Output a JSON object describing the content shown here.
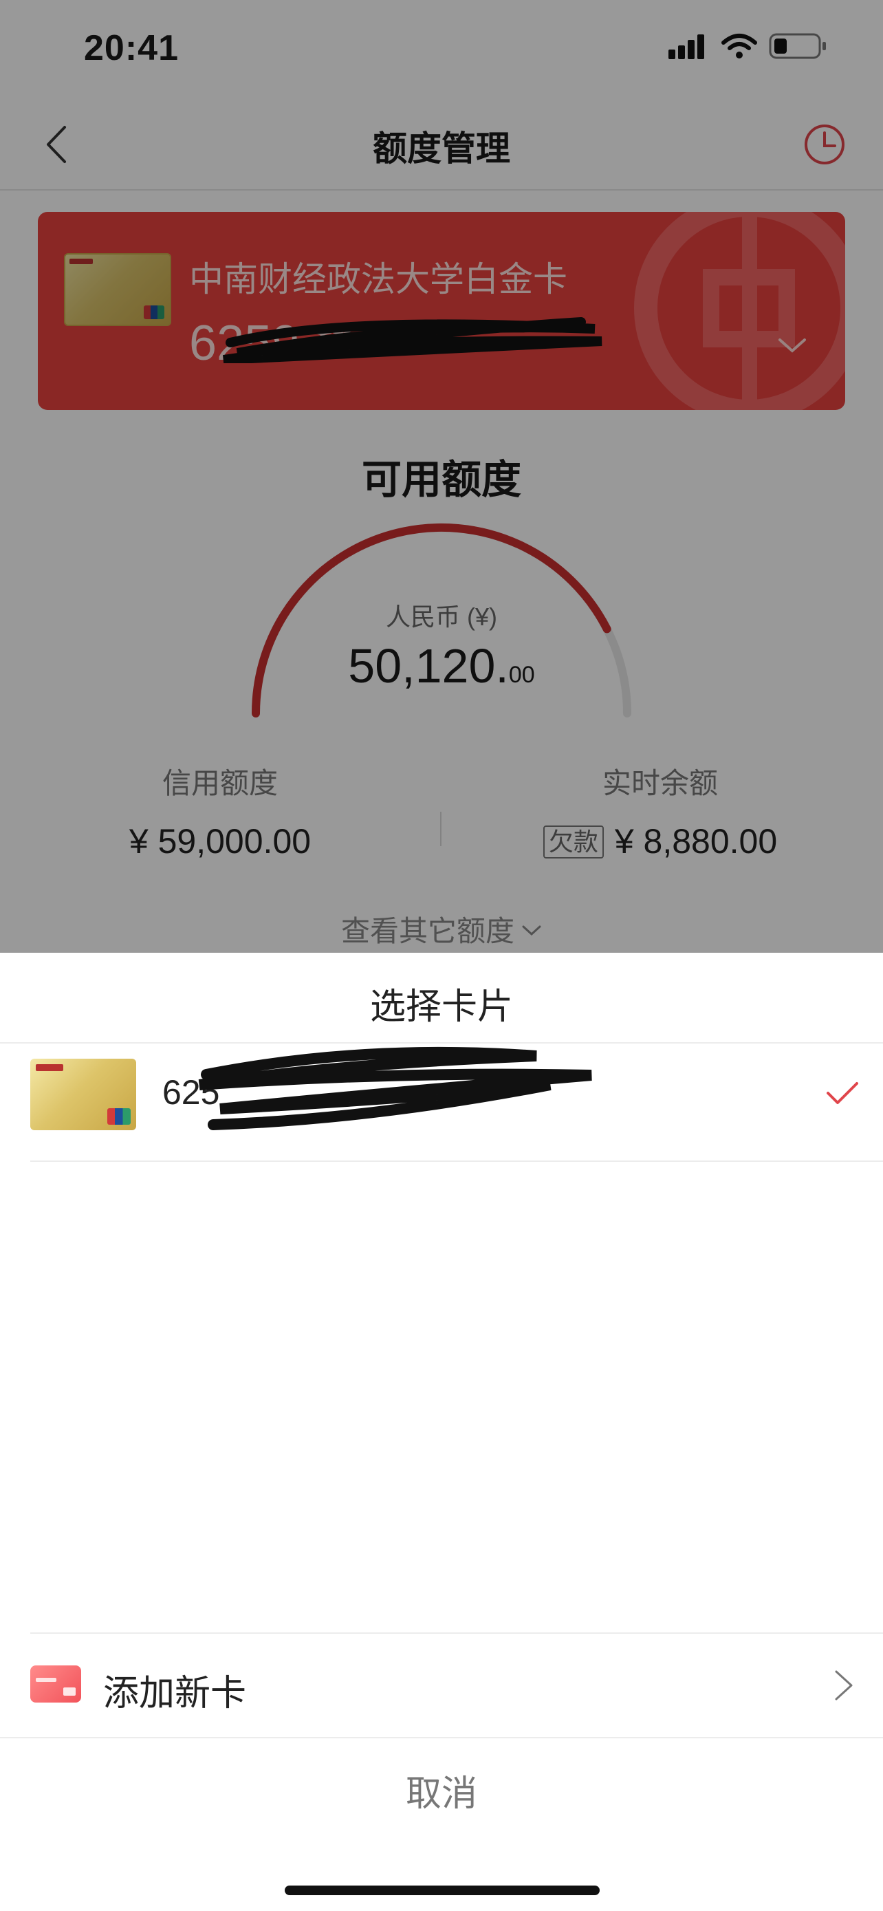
{
  "status_bar": {
    "time": "20:41",
    "icons": [
      "signal-icon",
      "wifi-icon",
      "battery-icon"
    ]
  },
  "nav": {
    "title": "额度管理",
    "back_icon": "chevron-left-icon",
    "history_icon": "clock-icon"
  },
  "card_banner": {
    "card_name": "中南财经政法大学白金卡",
    "card_number_visible": "6259 **",
    "background_color": "#e6413f",
    "expand_icon": "chevron-down-icon"
  },
  "available": {
    "title": "可用额度",
    "currency": "人民币 (¥)",
    "amount_main": "50,120.",
    "amount_cents": "00",
    "gauge_fraction": 0.85,
    "gauge_color": "#c8302f"
  },
  "credit_limit": {
    "label": "信用额度",
    "value": "¥ 59,000.00"
  },
  "balance": {
    "label": "实时余额",
    "tag": "欠款",
    "value": "¥ 8,880.00"
  },
  "more_link": {
    "label": "查看其它额度"
  },
  "sheet": {
    "title": "选择卡片",
    "cards": [
      {
        "number_visible": "625",
        "selected": true
      }
    ],
    "check_color": "#e0454b",
    "add_card": {
      "label": "添加新卡"
    },
    "cancel": {
      "label": "取消"
    }
  }
}
